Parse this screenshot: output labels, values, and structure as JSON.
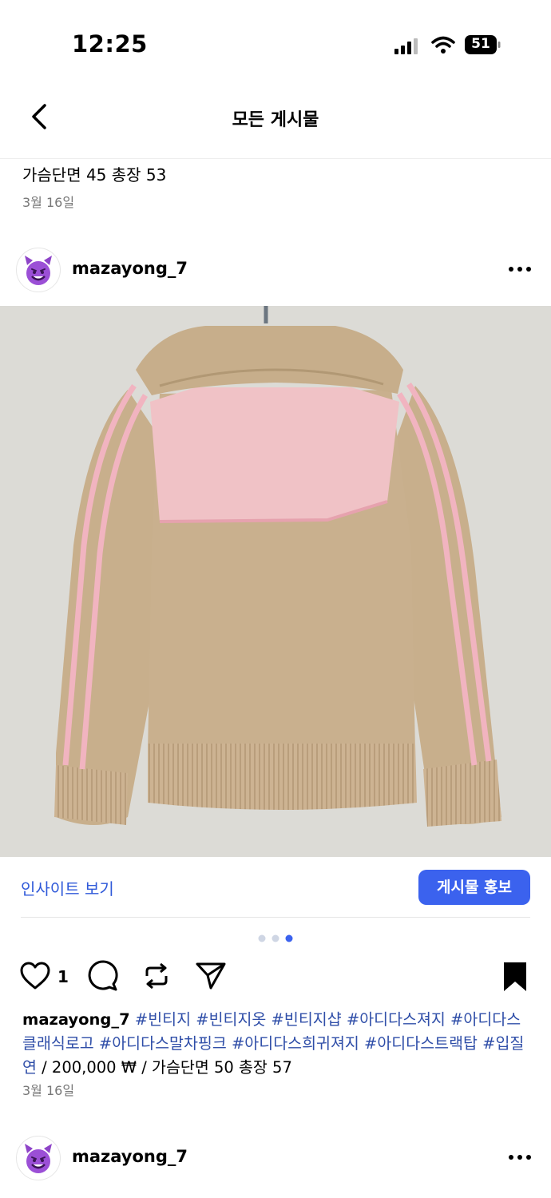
{
  "status_bar": {
    "time": "12:25",
    "battery": "51"
  },
  "nav": {
    "title": "모든 게시물"
  },
  "previous_post": {
    "caption": "가슴단면 45 총장 53",
    "date": "3월 16일"
  },
  "post": {
    "username": "mazayong_7",
    "insights_label": "인사이트 보기",
    "promote_label": "게시물 홍보",
    "carousel": {
      "total": 3,
      "active": 3
    },
    "likes": "1",
    "caption_user": "mazayong_7",
    "hashtags": [
      "#빈티지",
      "#빈티지옷",
      "#빈티지샵",
      "#아디다스져지",
      "#아디다스클래식로고",
      "#아디다스말차핑크",
      "#아디다스희귀져지",
      "#아디다스트랙탑",
      "#입질연"
    ],
    "caption_tail": " / 200,000 ₩ / 가슴단면 50 총장 57",
    "date": "3월 16일"
  },
  "next_post": {
    "username": "mazayong_7"
  },
  "colors": {
    "accent": "#3b62ee",
    "hashtag": "#2f4ea8",
    "link": "#2f59d9"
  }
}
